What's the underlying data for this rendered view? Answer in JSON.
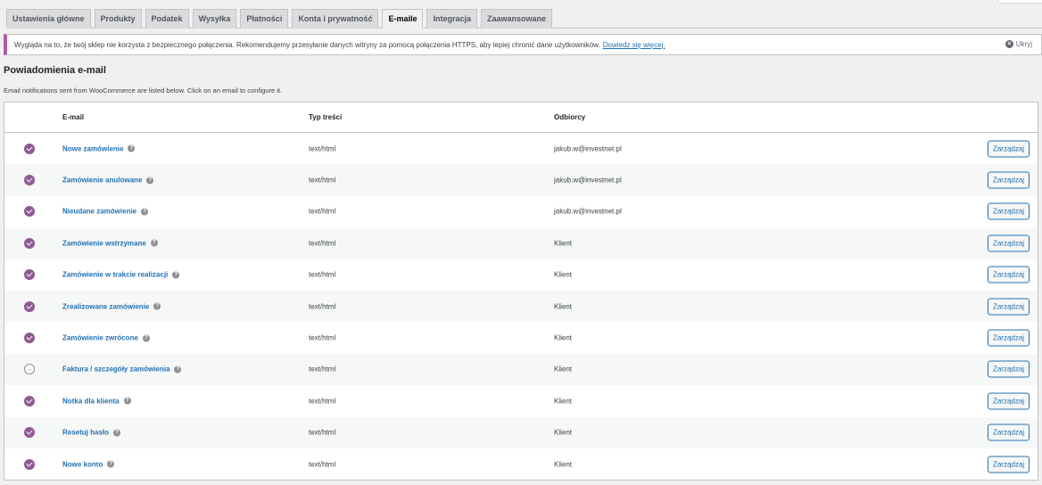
{
  "tabs": [
    {
      "label": "Ustawienia główne",
      "active": false
    },
    {
      "label": "Produkty",
      "active": false
    },
    {
      "label": "Podatek",
      "active": false
    },
    {
      "label": "Wysyłka",
      "active": false
    },
    {
      "label": "Płatności",
      "active": false
    },
    {
      "label": "Konta i prywatność",
      "active": false
    },
    {
      "label": "E-maile",
      "active": true
    },
    {
      "label": "Integracja",
      "active": false
    },
    {
      "label": "Zaawansowane",
      "active": false
    }
  ],
  "notice": {
    "text": "Wygląda na to, że twój sklep nie korzysta z bezpiecznego połączenia. Rekomendujemy przesyłanie danych witryny za pomocą połączenia HTTPS, aby lepiej chronić dane użytkowników.",
    "link": "Dowiedz się więcej.",
    "dismiss": "Ukryj",
    "accent": "#b15ca0"
  },
  "section": {
    "title": "Powiadomienia e-mail",
    "description": "Email notifications sent from WooCommerce are listed below. Click on an email to configure it."
  },
  "table": {
    "headers": {
      "email": "E-mail",
      "type": "Typ treści",
      "recipients": "Odbiorcy"
    },
    "rows": [
      {
        "name": "Nowe zamówienie",
        "type": "text/html",
        "recipient": "jakub.w@investnet.pl",
        "enabled": true,
        "action": "Zarządzaj"
      },
      {
        "name": "Zamówienie anulowane",
        "type": "text/html",
        "recipient": "jakub.w@investnet.pl",
        "enabled": true,
        "action": "Zarządzaj"
      },
      {
        "name": "Nieudane zamówienie",
        "type": "text/html",
        "recipient": "jakub.w@investnet.pl",
        "enabled": true,
        "action": "Zarządzaj"
      },
      {
        "name": "Zamówienie wstrzymane",
        "type": "text/html",
        "recipient": "Klient",
        "enabled": true,
        "action": "Zarządzaj"
      },
      {
        "name": "Zamówienie w trakcie realizacji",
        "type": "text/html",
        "recipient": "Klient",
        "enabled": true,
        "action": "Zarządzaj"
      },
      {
        "name": "Zrealizowane zamówienie",
        "type": "text/html",
        "recipient": "Klient",
        "enabled": true,
        "action": "Zarządzaj"
      },
      {
        "name": "Zamówienie zwrócone",
        "type": "text/html",
        "recipient": "Klient",
        "enabled": true,
        "action": "Zarządzaj"
      },
      {
        "name": "Faktura / szczegóły zamówienia",
        "type": "text/html",
        "recipient": "Klient",
        "enabled": false,
        "action": "Zarządzaj"
      },
      {
        "name": "Notka dla klienta",
        "type": "text/html",
        "recipient": "Klient",
        "enabled": true,
        "action": "Zarządzaj"
      },
      {
        "name": "Resetuj hasło",
        "type": "text/html",
        "recipient": "Klient",
        "enabled": true,
        "action": "Zarządzaj"
      },
      {
        "name": "Nowe konto",
        "type": "text/html",
        "recipient": "Klient",
        "enabled": true,
        "action": "Zarządzaj"
      }
    ]
  },
  "colors": {
    "link": "#2271b1",
    "enabled_icon": "#8f5a92"
  },
  "icons": {
    "enabled": "check-circle-icon",
    "disabled": "arrow-circle-icon",
    "help": "help-icon",
    "dismiss": "close-icon"
  }
}
